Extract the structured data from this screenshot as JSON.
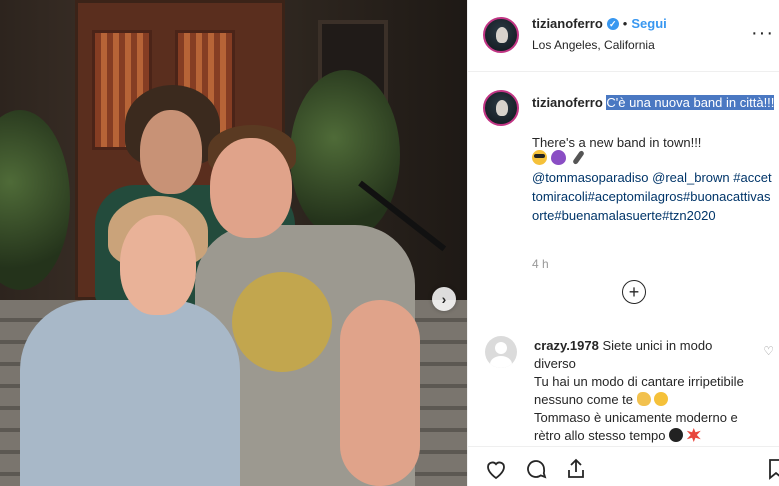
{
  "post": {
    "user": "tizianoferro",
    "follow_label": "Segui",
    "dot": "•",
    "location": "Los Angeles, California",
    "more_label": "···",
    "verified_glyph": "✓"
  },
  "caption": {
    "user": "tizianoferro",
    "highlighted": "C'è una nuova band in città!!!",
    "translation": "There's a new band in town!!!",
    "tags": "@tommasoparadiso @real_brown #accettomiracoli#aceptomilagros#buonacattivasorte#buenamalasuerte#tzn2020",
    "time": "4 h",
    "load_more_label": "+"
  },
  "comment": {
    "user": "crazy.1978",
    "line1": "Siete unici in modo diverso",
    "line2": "Tu hai un modo di cantare irripetibile nessuno come te",
    "line3": "Tommaso è unicamente moderno e rètro allo stesso tempo",
    "like_glyph": "♡"
  },
  "photo": {
    "next_glyph": "›"
  },
  "icons": [
    "heart-icon",
    "comment-icon",
    "share-icon",
    "bookmark-icon",
    "verified-icon",
    "more-icon",
    "next-arrow-icon",
    "plus-circle-icon"
  ],
  "colors": {
    "link": "#003569",
    "accent": "#3897f0",
    "highlight": "#4a78c2",
    "story_ring": "#c13584"
  }
}
